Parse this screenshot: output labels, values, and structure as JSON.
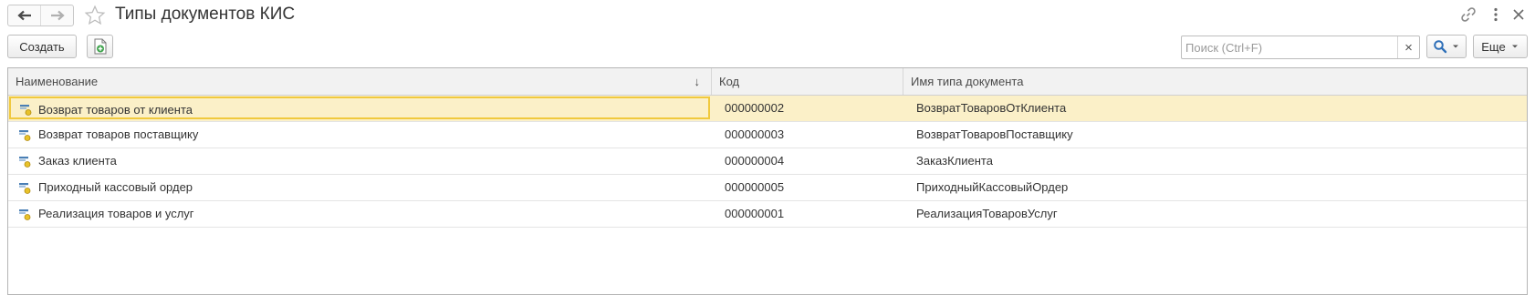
{
  "window": {
    "title": "Типы документов КИС"
  },
  "toolbar": {
    "create_label": "Создать",
    "more_label": "Еще",
    "search_placeholder": "Поиск (Ctrl+F)",
    "search_value": "",
    "clear_symbol": "×"
  },
  "icons": {
    "back": "arrow-left-icon",
    "forward": "arrow-right-icon",
    "favorite": "star-icon",
    "link": "link-icon",
    "menu": "kebab-menu-icon",
    "new_document": "new-document-icon",
    "search": "magnifier-icon",
    "dropdown": "chevron-down-icon",
    "row": "catalog-item-icon",
    "sort": "sort-down-arrow-icon"
  },
  "colors": {
    "selected_row_bg": "#fbf0c8",
    "selected_border": "#f0c93e",
    "search_icon": "#2e6fb8"
  },
  "table": {
    "columns": [
      {
        "label": "Наименование",
        "sort": "↓"
      },
      {
        "label": "Код"
      },
      {
        "label": "Имя типа документа"
      }
    ],
    "rows": [
      {
        "name": "Возврат товаров от клиента",
        "code": "000000002",
        "type_name": "ВозвратТоваровОтКлиента",
        "selected": true
      },
      {
        "name": "Возврат товаров поставщику",
        "code": "000000003",
        "type_name": "ВозвратТоваровПоставщику",
        "selected": false
      },
      {
        "name": "Заказ клиента",
        "code": "000000004",
        "type_name": "ЗаказКлиента",
        "selected": false
      },
      {
        "name": "Приходный кассовый ордер",
        "code": "000000005",
        "type_name": "ПриходныйКассовыйОрдер",
        "selected": false
      },
      {
        "name": "Реализация товаров и услуг",
        "code": "000000001",
        "type_name": "РеализацияТоваровУслуг",
        "selected": false
      }
    ]
  }
}
